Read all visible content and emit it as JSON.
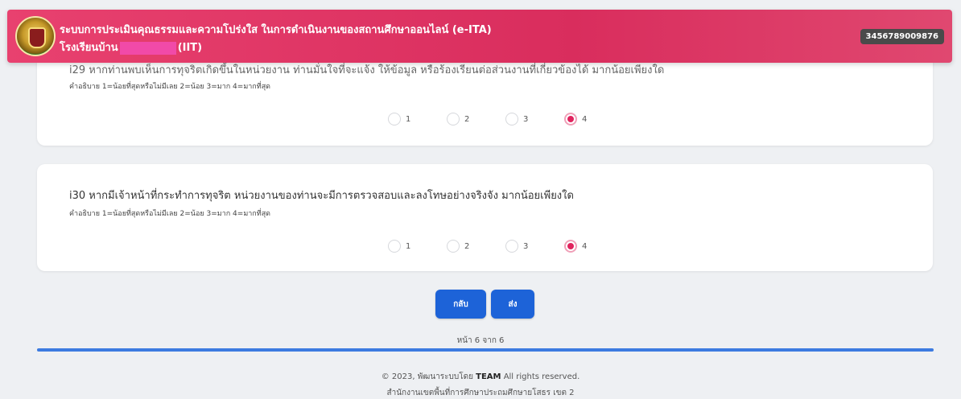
{
  "header": {
    "title": "ระบบการประเมินคุณธรรมและความโปร่งใส ในการดำเนินงานของสถานศึกษาออนไลน์ (e-ITA)",
    "school_prefix": "โรงเรียนบ้าน",
    "school_suffix": "(IIT)",
    "id_badge": "3456789009876"
  },
  "questions": [
    {
      "title": "i29 หากท่านพบเห็นการทุจริตเกิดขึ้นในหน่วยงาน ท่านมั่นใจที่จะแจ้ง ให้ข้อมูล หรือร้องเรียนต่อส่วนงานที่เกี่ยวข้องได้ มากน้อยเพียงใด",
      "desc": "คำอธิบาย 1=น้อยที่สุดหรือไม่มีเลย 2=น้อย 3=มาก 4=มากที่สุด",
      "options": [
        "1",
        "2",
        "3",
        "4"
      ],
      "selected": "4"
    },
    {
      "title": "i30 หากมีเจ้าหน้าที่กระทำการทุจริต หน่วยงานของท่านจะมีการตรวจสอบและลงโทษอย่างจริงจัง มากน้อยเพียงใด",
      "desc": "คำอธิบาย 1=น้อยที่สุดหรือไม่มีเลย 2=น้อย 3=มาก 4=มากที่สุด",
      "options": [
        "1",
        "2",
        "3",
        "4"
      ],
      "selected": "4"
    }
  ],
  "buttons": {
    "back_label": "กลับ",
    "send_label": "ส่ง"
  },
  "pager": {
    "text": "หน้า 6 จาก 6"
  },
  "footer": {
    "copyright_pre": "© 2023, พัฒนาระบบโดย",
    "team": "TEAM",
    "copyright_post": "All rights reserved.",
    "office": "สำนักงานเขตพื้นที่การศึกษาประถมศึกษายโสธร เขต 2"
  },
  "colors": {
    "header": "#e0245e",
    "button": "#1d63d8",
    "selected_radio": "#e0245e",
    "progress": "#3c7be0"
  }
}
